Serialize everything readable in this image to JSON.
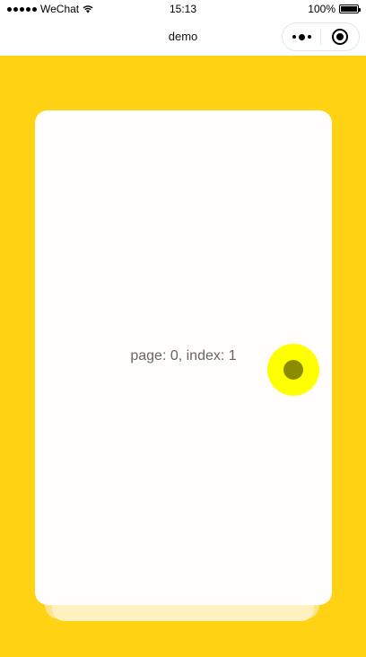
{
  "status_bar": {
    "carrier": "WeChat",
    "time": "15:13",
    "battery": "100%"
  },
  "nav": {
    "title": "demo",
    "icons": [
      "more-icon",
      "close-circle-icon"
    ]
  },
  "card": {
    "label": "page: 0, index: 1"
  },
  "colors": {
    "background": "#FFD313",
    "card": "#FFFEFC",
    "touch_indicator": "#FFFF00"
  }
}
